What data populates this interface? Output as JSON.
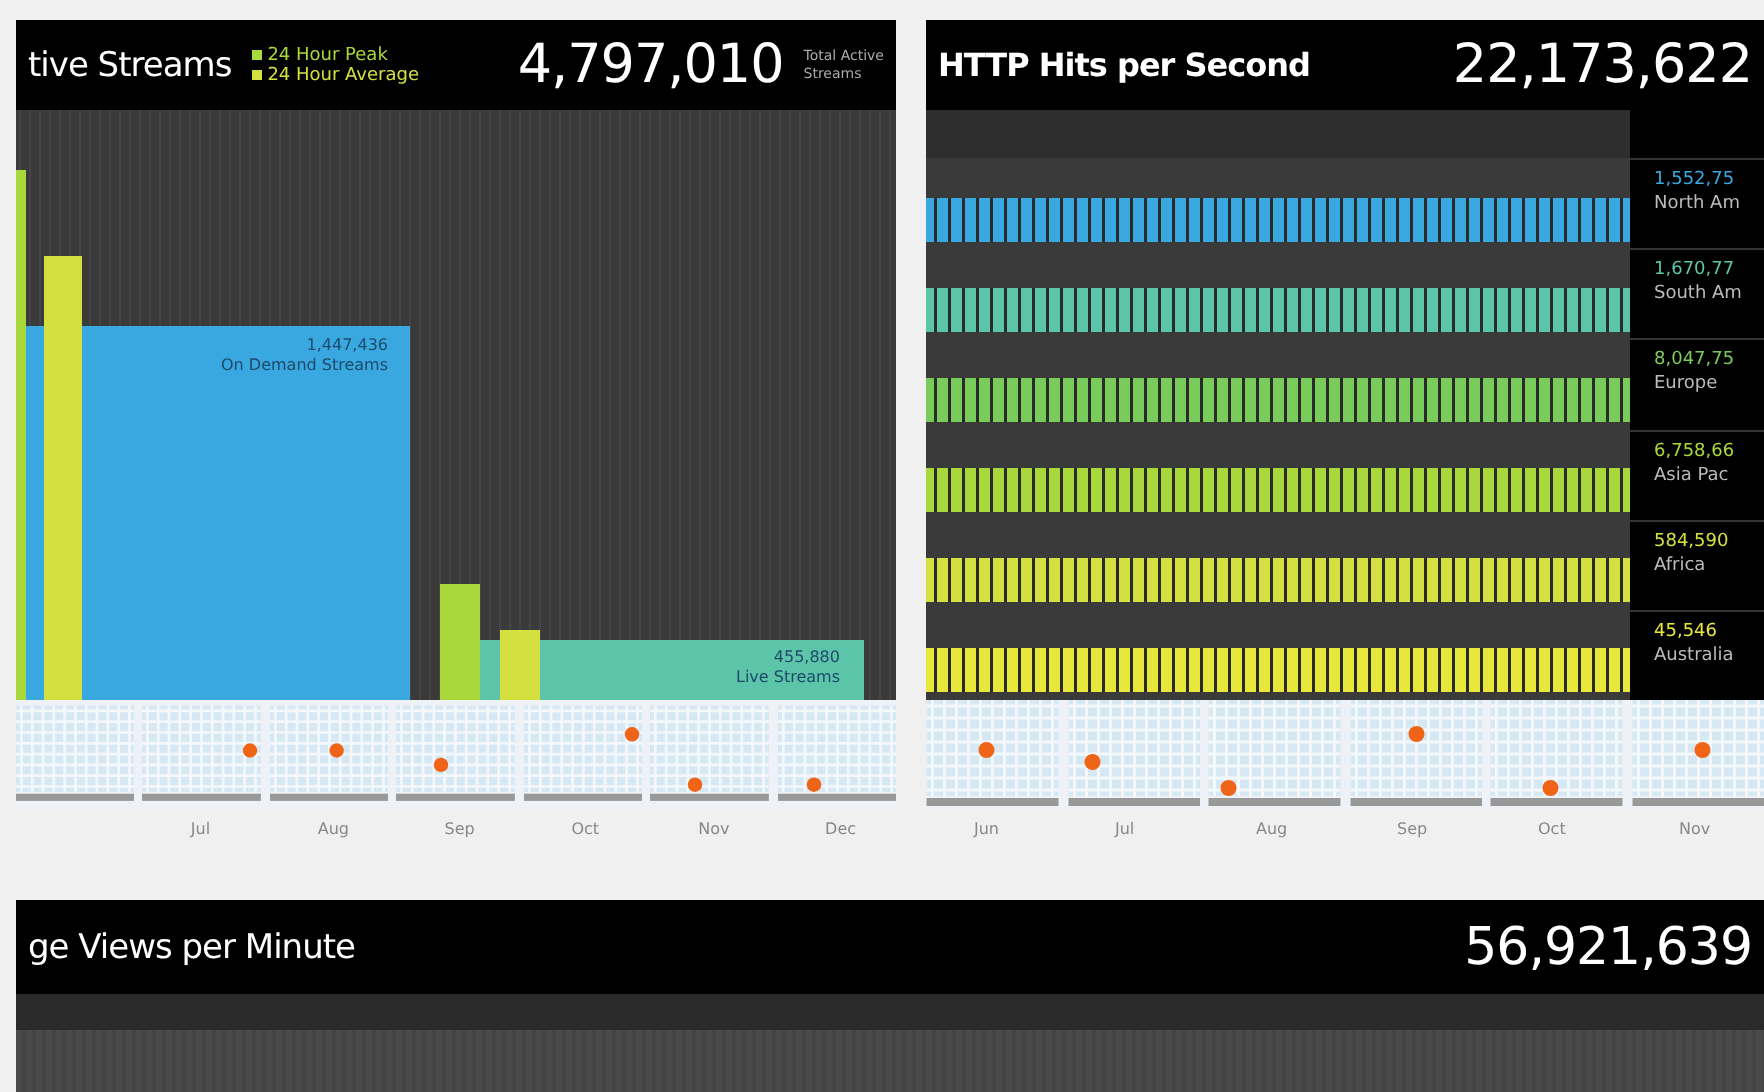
{
  "streams": {
    "title": "tive Streams",
    "legend": [
      {
        "label": "24 Hour Peak",
        "color": "#a8d83c"
      },
      {
        "label": "24 Hour Average",
        "color": "#d4e040"
      }
    ],
    "total": "4,797,010",
    "total_caption": [
      "Total Active",
      "Streams"
    ],
    "segments": [
      {
        "value": "1,447,436",
        "label": "On Demand Streams",
        "color": "#3aa8e0"
      },
      {
        "value": "455,880",
        "label": "Live Streams",
        "color": "#5cc4a8"
      }
    ],
    "months": [
      "Jul",
      "Aug",
      "Sep",
      "Oct",
      "Nov",
      "Dec"
    ]
  },
  "hits": {
    "title": "HTTP Hits per Second",
    "total": "22,173,622",
    "rows": [
      {
        "value": "1,552,75",
        "name": "North Am",
        "color": "#3aa8e0"
      },
      {
        "value": "1,670,77",
        "name": "South Am",
        "color": "#5cc4a8"
      },
      {
        "value": "8,047,75",
        "name": "Europe",
        "color": "#7acc5a"
      },
      {
        "value": "6,758,66",
        "name": "Asia Pac",
        "color": "#a8d83c"
      },
      {
        "value": "584,590",
        "name": "Africa",
        "color": "#d4e040"
      },
      {
        "value": "45,546",
        "name": "Australia",
        "color": "#e8e83c"
      }
    ],
    "months": [
      "Jun",
      "Jul",
      "Aug",
      "Sep",
      "Oct",
      "Nov"
    ]
  },
  "views": {
    "title": "ge Views per Minute",
    "total": "56,921,639"
  }
}
